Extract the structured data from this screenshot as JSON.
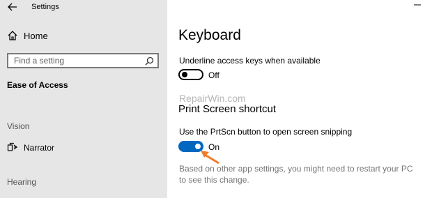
{
  "titlebar": {
    "title": "Settings",
    "back_icon": "back-arrow-icon",
    "minimize_icon": "minimize-icon"
  },
  "sidebar": {
    "home_label": "Home",
    "search_placeholder": "Find a setting",
    "current_section": "Ease of Access",
    "groups": [
      {
        "label": "Vision"
      },
      {
        "label": "Hearing"
      }
    ],
    "narrator_label": "Narrator"
  },
  "main": {
    "title": "Keyboard",
    "underline": {
      "label": "Underline access keys when available",
      "state": "Off",
      "on": false
    },
    "watermark": "RepairWin.com",
    "print_screen": {
      "heading": "Print Screen shortcut",
      "label": "Use the PrtScn button to open screen snipping",
      "state": "On",
      "on": true,
      "note": "Based on other app settings, you might need to restart your PC to see this change."
    }
  },
  "colors": {
    "sidebar_bg": "#e6e6e6",
    "accent": "#0067c0",
    "annotation_arrow": "#f07c2a"
  }
}
